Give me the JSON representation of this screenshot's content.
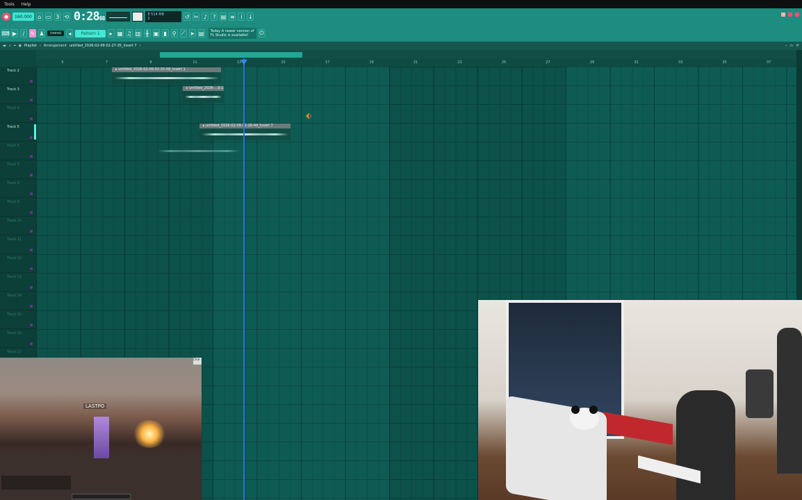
{
  "menu": {
    "tools": "Tools",
    "help": "Help"
  },
  "transport": {
    "bpm": "160.000",
    "time": "0:28",
    "time_frac": "68",
    "cpu_top": "8      514 MB",
    "cpu_bottom": "2"
  },
  "toolbar2": {
    "pattern_none": "(none)",
    "pattern": "Pattern 1",
    "news_line1": "Today  A newer version of",
    "news_line2": "FL Studio is available!"
  },
  "playlist": {
    "title": "Playlist",
    "sep": "›",
    "arrangement": "Arrangement",
    "insert_name": "untitled_2026-02-09 02-27-35_Insert 7",
    "insert_arrow": "›"
  },
  "ruler_ticks": [
    "5",
    "7",
    "9",
    "11",
    "13",
    "15",
    "17",
    "19",
    "21",
    "23",
    "25",
    "27",
    "29",
    "31",
    "33",
    "35",
    "37"
  ],
  "tracks": [
    {
      "label": "Track 2",
      "named": true
    },
    {
      "label": "Track 3",
      "named": true
    },
    {
      "label": "Track 4",
      "named": false
    },
    {
      "label": "Track 5",
      "named": true,
      "selected": true
    },
    {
      "label": "Track 6",
      "named": false
    },
    {
      "label": "Track 7",
      "named": false
    },
    {
      "label": "Track 8",
      "named": false
    },
    {
      "label": "Track 9",
      "named": false
    },
    {
      "label": "Track 10",
      "named": false
    },
    {
      "label": "Track 11",
      "named": false
    },
    {
      "label": "Track 12",
      "named": false
    },
    {
      "label": "Track 13",
      "named": false
    },
    {
      "label": "Track 14",
      "named": false
    },
    {
      "label": "Track 15",
      "named": false
    },
    {
      "label": "Track 16",
      "named": false
    },
    {
      "label": "Track 17",
      "named": false
    }
  ],
  "clips": [
    {
      "name": "untitled_2026-02-09 02-25-58_Insert 1",
      "track": "Track 2"
    },
    {
      "name": "untitled_2026-...9-15_Insert 7",
      "track": "Track 3"
    },
    {
      "name": "untitled_2026-02-09 02-26-44_Insert 7",
      "track": "Track 5"
    }
  ],
  "game_overlay": {
    "nameplate": "LASTPO",
    "sliver": "Chat"
  }
}
